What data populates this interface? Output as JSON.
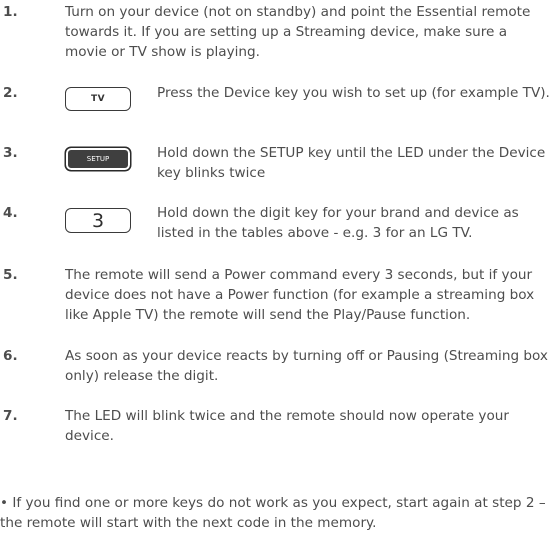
{
  "steps": [
    {
      "number": "1.",
      "text": "Turn on your device (not on standby) and point the Essential remote towards it. If you are setting up a Streaming device, make sure a movie or TV show is playing."
    },
    {
      "number": "2.",
      "key_label": "TV",
      "text": "Press the Device key you wish to set up (for example TV)."
    },
    {
      "number": "3.",
      "key_label": "SETUP",
      "text": "Hold down the SETUP key until the LED under the Device key blinks twice"
    },
    {
      "number": "4.",
      "key_label": "3",
      "text": "Hold down the digit key for your brand and device as listed in the tables above - e.g. 3 for an LG TV."
    },
    {
      "number": "5.",
      "text": "The remote will send a Power command every 3 seconds, but if your device does not have a Power function (for example a streaming box like Apple TV) the remote will send the Play/Pause function."
    },
    {
      "number": "6.",
      "text": "As soon as your device reacts by turning off or Pausing (Streaming box only) release the digit."
    },
    {
      "number": "7.",
      "text": "The LED will blink twice and the remote should now operate your device."
    }
  ],
  "note": "• If you find one or more keys do not work as you expect, start again at step 2 – the remote will start with the next code in the memory."
}
